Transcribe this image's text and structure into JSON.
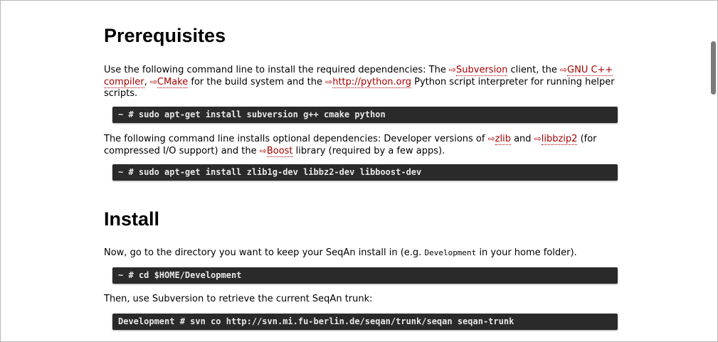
{
  "sections": {
    "prerequisites": {
      "title": "Prerequisites",
      "para1": {
        "t1": "Use the following command line to install the required dependencies: The ",
        "link_subversion": "Subversion",
        "t2": " client, the ",
        "link_gnu": "GNU C++ compiler",
        "t3": ", ",
        "link_cmake": "CMake",
        "t4": " for the build system and the ",
        "link_python": "http://python.org",
        "t5": " Python script interpreter for running helper scripts."
      },
      "cmd1": "~ # sudo apt-get install subversion g++ cmake python",
      "para2": {
        "t1": "The following command line installs optional dependencies: Developer versions of ",
        "link_zlib": "zlib",
        "t2": " and ",
        "link_libbzip2": "libbzip2",
        "t3": " (for compressed I/O support) and the ",
        "link_boost": "Boost",
        "t4": " library (required by a few apps)."
      },
      "cmd2": "~ # sudo apt-get install zlib1g-dev libbz2-dev libboost-dev"
    },
    "install": {
      "title": "Install",
      "para1": {
        "t1": "Now, go to the directory you want to keep your SeqAn install in (e.g. ",
        "code": "Development",
        "t2": " in your home folder)."
      },
      "cmd1": "~ # cd $HOME/Development",
      "para2": "Then, use Subversion to retrieve the current SeqAn trunk:",
      "cmd2": "Development # svn co http://svn.mi.fu-berlin.de/seqan/trunk/seqan seqan-trunk"
    }
  },
  "icons": {
    "external_link": "⇨"
  },
  "colors": {
    "link": "#a30000",
    "code_bg": "#2a2a2a",
    "code_text": "#e8e8e8"
  }
}
